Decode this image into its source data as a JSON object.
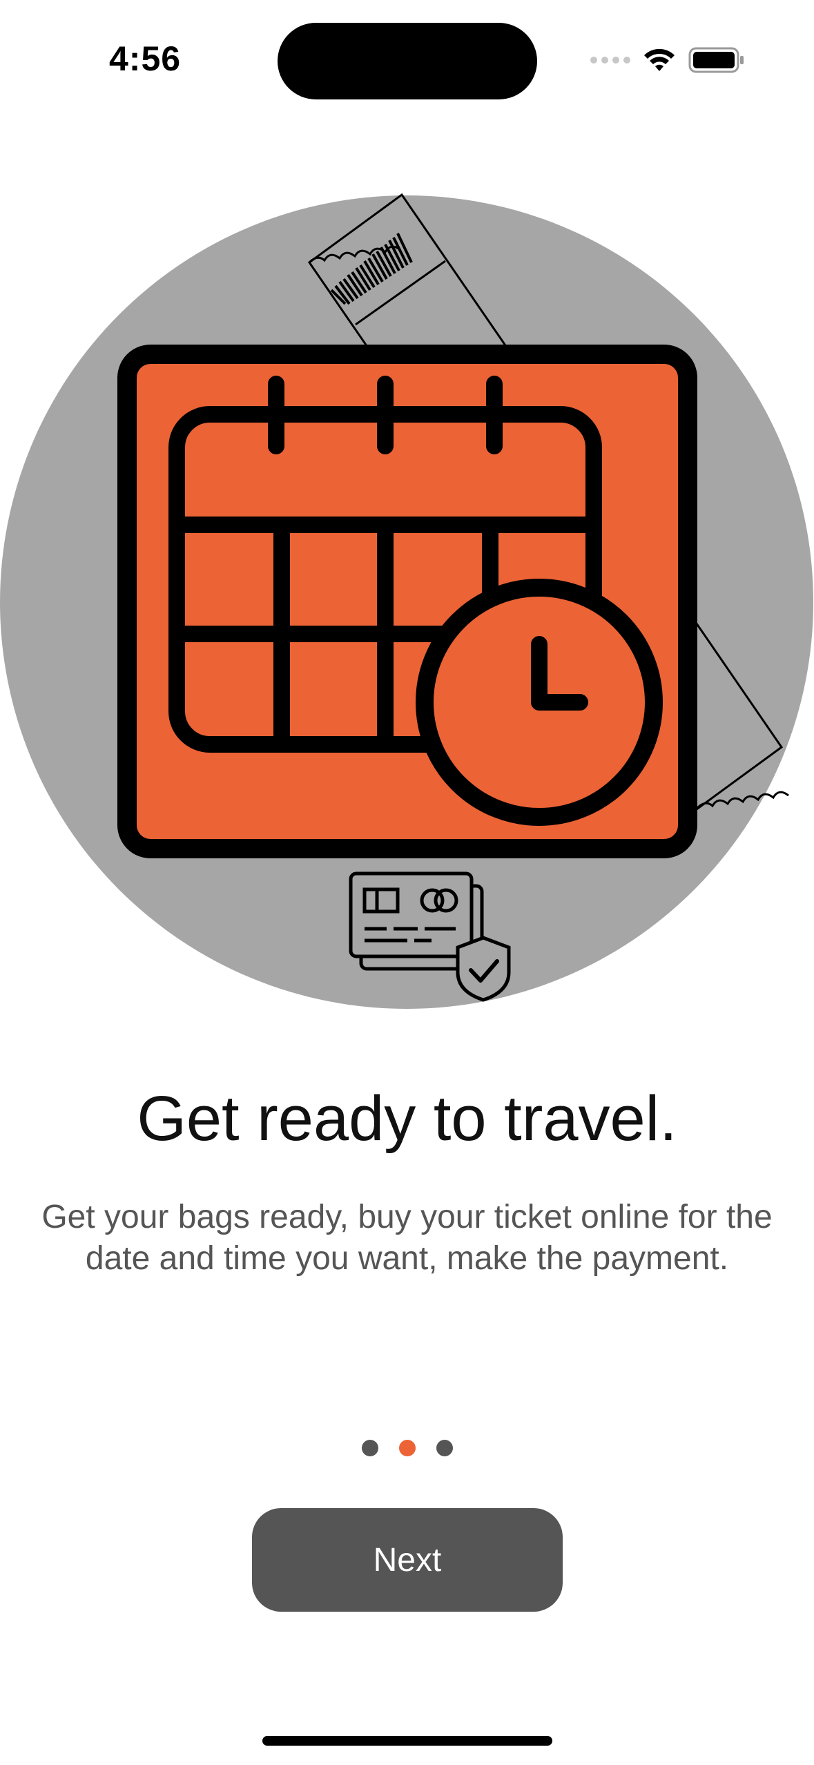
{
  "status_bar": {
    "time": "4:56"
  },
  "onboarding": {
    "title": "Get ready to travel.",
    "subtitle": "Get your bags ready, buy your ticket online for the date and time you want, make the payment.",
    "pager": {
      "total": 3,
      "active_index": 1
    },
    "next_label": "Next"
  },
  "colors": {
    "accent": "#EC6335",
    "circle": "#A6A6A6",
    "button": "#555555",
    "text_primary": "#111111",
    "text_secondary": "#555555"
  },
  "icons": [
    "wifi-icon",
    "battery-icon",
    "calendar-icon",
    "clock-icon",
    "ticket-icon",
    "credit-card-icon",
    "shield-check-icon"
  ]
}
